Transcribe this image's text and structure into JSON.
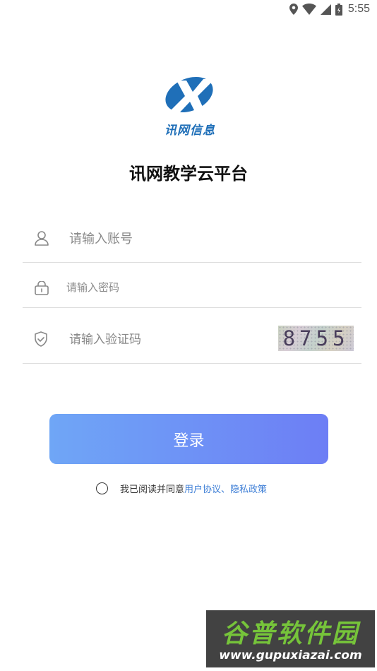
{
  "status_bar": {
    "time": "5:55",
    "icons": [
      "location-icon",
      "wifi-icon",
      "signal-icon",
      "battery-icon"
    ]
  },
  "brand": {
    "logo_text": "讯网信息",
    "logo_colors": {
      "blue": "#1f6fb8"
    },
    "app_title": "讯网教学云平台"
  },
  "form": {
    "account": {
      "icon": "user-icon",
      "placeholder": "请输入账号",
      "value": ""
    },
    "password": {
      "icon": "lock-icon",
      "placeholder": "请输入密码",
      "value": ""
    },
    "captcha": {
      "icon": "shield-check-icon",
      "placeholder": "请输入验证码",
      "value": "",
      "image_code": "8755"
    },
    "login_label": "登录"
  },
  "agreement": {
    "checked": false,
    "text": "我已阅读并同意",
    "link": "用户协议、隐私政策",
    "link_color": "#3d7ed6"
  },
  "watermark": {
    "title": "谷普软件园",
    "url": "www.gupuxiazai.com"
  },
  "colors": {
    "button_gradient_start": "#6fa6f6",
    "button_gradient_end": "#6d7ef5",
    "divider": "#dddddd"
  }
}
